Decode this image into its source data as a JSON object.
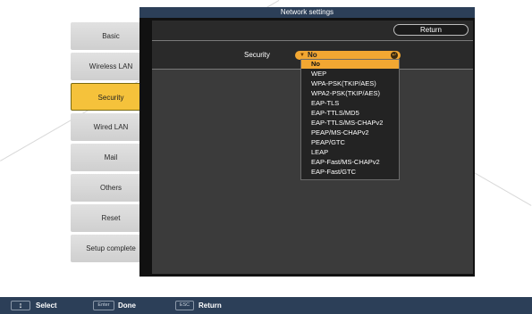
{
  "window": {
    "title": "Network settings",
    "return_label": "Return",
    "security_label": "Security"
  },
  "tabs": [
    {
      "label": "Basic",
      "active": false
    },
    {
      "label": "Wireless LAN",
      "active": false
    },
    {
      "label": "Security",
      "active": true
    },
    {
      "label": "Wired LAN",
      "active": false
    },
    {
      "label": "Mail",
      "active": false
    },
    {
      "label": "Others",
      "active": false
    },
    {
      "label": "Reset",
      "active": false
    },
    {
      "label": "Setup complete",
      "active": false
    }
  ],
  "security_select": {
    "value": "No",
    "arrow_icon": "triangle-down-icon",
    "knob_icon": "enter-circle-icon",
    "options": [
      "No",
      "WEP",
      "WPA-PSK(TKIP/AES)",
      "WPA2-PSK(TKIP/AES)",
      "EAP-TLS",
      "EAP-TTLS/MD5",
      "EAP-TTLS/MS-CHAPv2",
      "PEAP/MS-CHAPv2",
      "PEAP/GTC",
      "LEAP",
      "EAP-Fast/MS-CHAPv2",
      "EAP-Fast/GTC"
    ],
    "selected_index": 0
  },
  "bottom_bar": {
    "select_key_icon": "up-down-arrow-icon",
    "select_label": "Select",
    "done_key": "Enter",
    "done_label": "Done",
    "return_key": "ESC",
    "return_label": "Return"
  },
  "colors": {
    "title_bar": "#2c3f58",
    "accent": "#f2a732",
    "active_tab": "#f5c23b"
  }
}
